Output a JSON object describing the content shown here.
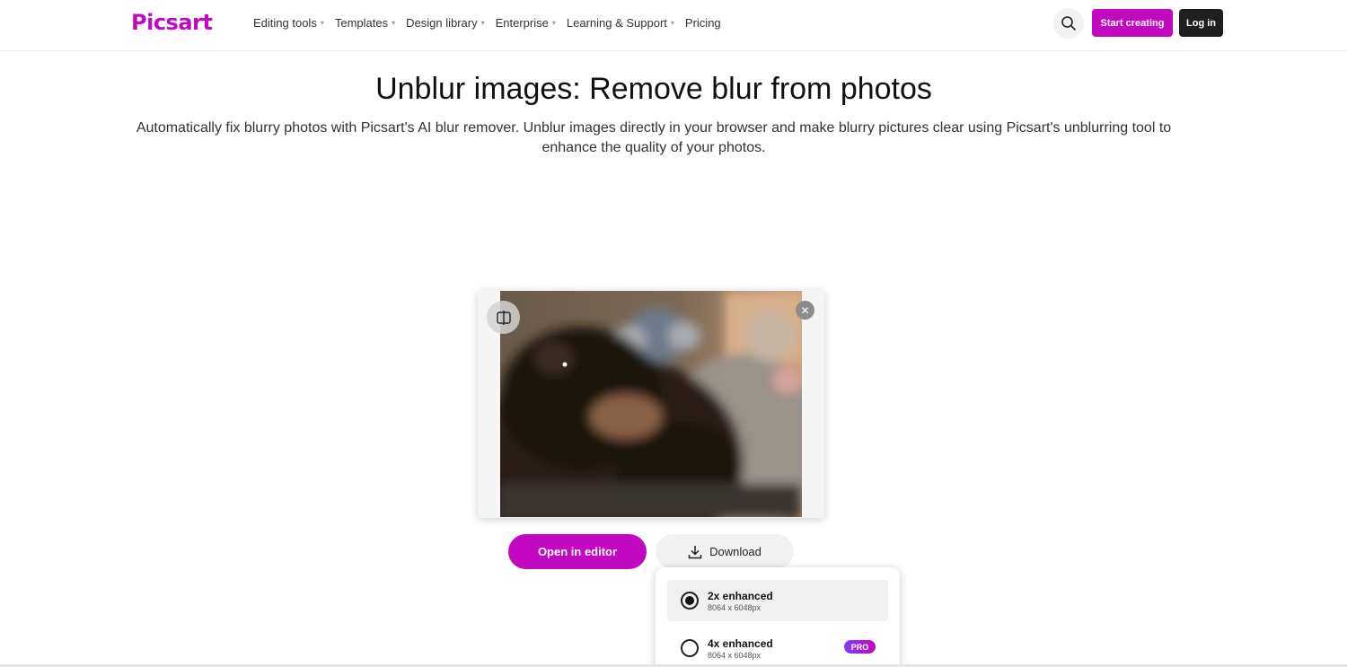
{
  "header": {
    "logo": "Picsart",
    "nav": [
      {
        "label": "Editing tools",
        "caret": true
      },
      {
        "label": "Templates",
        "caret": true
      },
      {
        "label": "Design library",
        "caret": true
      },
      {
        "label": "Enterprise",
        "caret": true
      },
      {
        "label": "Learning & Support",
        "caret": true
      },
      {
        "label": "Pricing",
        "caret": false
      }
    ],
    "start_creating": "Start creating",
    "login": "Log in"
  },
  "hero": {
    "title": "Unblur images: Remove blur from photos",
    "subtitle": "Automatically fix blurry photos with Picsart's AI blur remover. Unblur images directly in your browser and make blurry pictures clear using Picsart's unblurring tool to enhance the quality of your photos."
  },
  "actions": {
    "open_editor": "Open in editor",
    "download": "Download"
  },
  "download_menu": {
    "options": [
      {
        "name": "2x enhanced",
        "size": "8064 x 6048px",
        "selected": true
      },
      {
        "name": "4x enhanced",
        "size": "8064 x 6048px",
        "selected": false,
        "badge": "PRO"
      }
    ]
  },
  "colors": {
    "brand": "#c209c1",
    "dark": "#1f1f1f"
  }
}
